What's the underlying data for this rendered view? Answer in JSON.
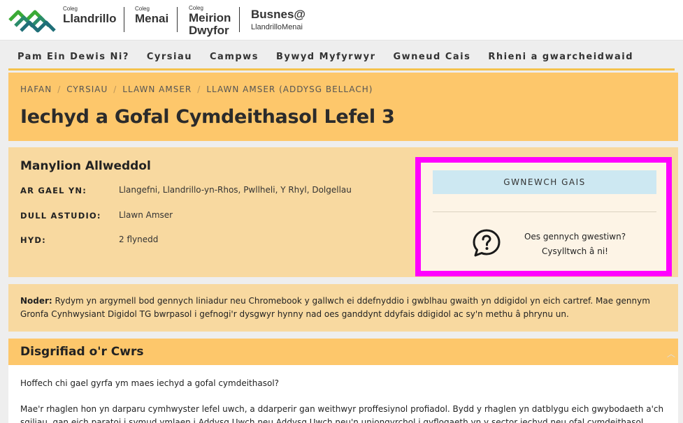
{
  "header": {
    "brands": [
      {
        "small": "Coleg",
        "big": "Llandrillo"
      },
      {
        "small": "Coleg",
        "big": "Menai"
      },
      {
        "small": "Coleg",
        "big": "Meirion",
        "big2": "Dwyfor"
      },
      {
        "big": "Busnes@",
        "sub": "LlandrilloMenai"
      }
    ]
  },
  "nav": {
    "items": [
      {
        "label": "Pam Ein Dewis Ni?"
      },
      {
        "label": "Cyrsiau"
      },
      {
        "label": "Campws"
      },
      {
        "label": "Bywyd Myfyrwyr"
      },
      {
        "label": "Gwneud Cais"
      },
      {
        "label": "Rhieni a gwarcheidwaid"
      }
    ]
  },
  "breadcrumb": [
    "HAFAN",
    "CYRSIAU",
    "LLAWN AMSER",
    "LLAWN AMSER (ADDYSG BELLACH)"
  ],
  "page_title": "Iechyd a Gofal Cymdeithasol Lefel 3",
  "key_details": {
    "title": "Manylion Allweddol",
    "rows": [
      {
        "label": "AR GAEL YN:",
        "value": "Llangefni, Llandrillo-yn-Rhos, Pwllheli, Y Rhyl, Dolgellau"
      },
      {
        "label": "DULL ASTUDIO:",
        "value": "Llawn Amser"
      },
      {
        "label": "HYD:",
        "value": "2 flynedd"
      }
    ]
  },
  "apply_panel": {
    "button_label": "GWNEWCH GAIS",
    "contact_line1": "Oes gennych gwestiwn?",
    "contact_line2": "Cysylltwch â ni!",
    "highlight_color": "#ff00ff"
  },
  "note": {
    "label": "Noder:",
    "text": " Rydym yn argymell bod gennych liniadur neu Chromebook y gallwch ei ddefnyddio i gwblhau gwaith yn ddigidol yn eich cartref. Mae gennym Gronfa Cynhwysiant Digidol TG bwrpasol i gefnogi'r dysgwyr hynny nad oes ganddynt ddyfais ddigidol ac sy'n methu â phrynu un."
  },
  "description": {
    "title": "Disgrifiad o'r Cwrs",
    "p1": "Hoffech chi gael gyrfa ym maes iechyd a gofal cymdeithasol?",
    "p2": "Mae'r rhaglen hon yn darparu cymhwyster lefel uwch, a ddarperir gan weithwyr proffesiynol profiadol. Bydd y rhaglen yn datblygu eich gwybodaeth a'ch sgiliau, gan eich paratoi i symud ymlaen i Addysg Uwch neu Addysg Uwch neu'n uniongyrchol i gyflogaeth yn y sector iechyd neu ofal cymdeithasol. Mae'n darparu rhaglen"
  },
  "colors": {
    "accent": "#fdc76b",
    "panel": "#f8d9a0",
    "button": "#cde8f2",
    "logo_green": "#3aaa35",
    "logo_teal": "#1f6f78"
  },
  "icons": {
    "logo": "wave-logo-icon",
    "question": "question-bubble-icon",
    "collapse": "chevron-up-icon"
  }
}
